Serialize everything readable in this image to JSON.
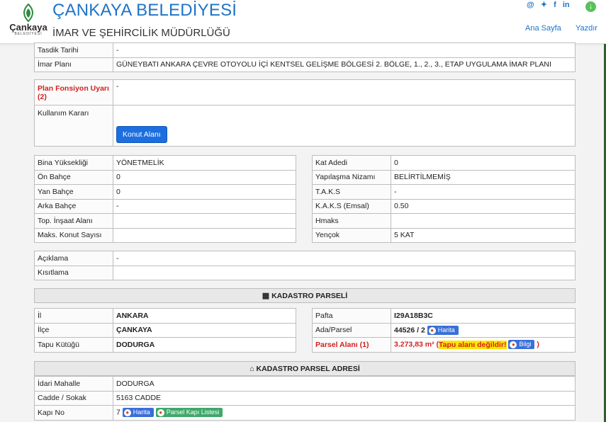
{
  "header": {
    "logo_word": "Çankaya",
    "logo_sub": "BELEDİYESİ",
    "title": "ÇANKAYA BELEDİYESİ",
    "subtitle": "İMAR VE ŞEHİRCİLİK MÜDÜRLÜĞÜ",
    "social": [
      "@",
      "🐦",
      "f",
      "in"
    ],
    "nav": [
      "Ana Sayfa",
      "Yazdır"
    ]
  },
  "top_rows": [
    {
      "label": "Tasdik Tarihi",
      "value": "-"
    },
    {
      "label": "İmar Planı",
      "value": "GÜNEYBATI ANKARA ÇEVRE OTOYOLU İÇİ KENTSEL GELİŞME BÖLGESİ 2. BÖLGE, 1., 2., 3., ETAP UYGULAMA İMAR PLANI"
    }
  ],
  "plan_box": {
    "warning_label": "Plan Fonsiyon Uyarı",
    "warning_sup": "(2)",
    "warning_value": "-",
    "kullanim_label": "Kullanım Kararı",
    "konut_button": "Konut Alanı"
  },
  "left_details": [
    {
      "label": "Bina Yüksekliği",
      "value": "YÖNETMELİK"
    },
    {
      "label": "Ön Bahçe",
      "value": "0"
    },
    {
      "label": "Yan Bahçe",
      "value": "0"
    },
    {
      "label": "Arka Bahçe",
      "value": "-"
    },
    {
      "label": "Top. İnşaat Alanı",
      "value": ""
    },
    {
      "label": "Maks. Konut Sayısı",
      "value": ""
    }
  ],
  "right_details": [
    {
      "label": "Kat Adedi",
      "value": "0"
    },
    {
      "label": "Yapılaşma Nizamı",
      "value": "BELİRTİLMEMİŞ"
    },
    {
      "label": "T.A.K.S",
      "value": "-"
    },
    {
      "label": "K.A.K.S (Emsal)",
      "value": "0.50"
    },
    {
      "label": "Hmaks",
      "value": ""
    },
    {
      "label": "Yençok",
      "value": "5 KAT"
    }
  ],
  "notes": [
    {
      "label": "Açıklama",
      "value": "-"
    },
    {
      "label": "Kısıtlama",
      "value": ""
    }
  ],
  "kadastro": {
    "title": "KADASTRO PARSELİ",
    "left": [
      {
        "label": "İl",
        "value": "ANKARA"
      },
      {
        "label": "İlçe",
        "value": "ÇANKAYA"
      },
      {
        "label": "Tapu Kütüğü",
        "value": "DODURGA"
      }
    ],
    "pafta_label": "Pafta",
    "pafta_value": "I29A18B3C",
    "ada_label": "Ada/Parsel",
    "ada_value": "44526 / 2",
    "harita_btn": "Harita",
    "parsel_alani_label": "Parsel Alanı",
    "parsel_alani_sup": "(1)",
    "parsel_alani_value": "3.273,83 m²",
    "tapu_warning": "Tapu alanı değildir!",
    "bilgi_btn": "Bilgi",
    "paren_open": "(",
    "paren_close": ")"
  },
  "adres": {
    "title": "KADASTRO PARSEL ADRESİ",
    "rows": [
      {
        "label": "İdari Mahalle",
        "value": "DODURGA"
      },
      {
        "label": "Cadde / Sokak",
        "value": "5163 CADDE"
      }
    ],
    "kapi_label": "Kapı No",
    "kapi_value": "7",
    "harita_btn": "Harita",
    "kapi_listesi_btn": "Parsel Kapı Listesi"
  }
}
